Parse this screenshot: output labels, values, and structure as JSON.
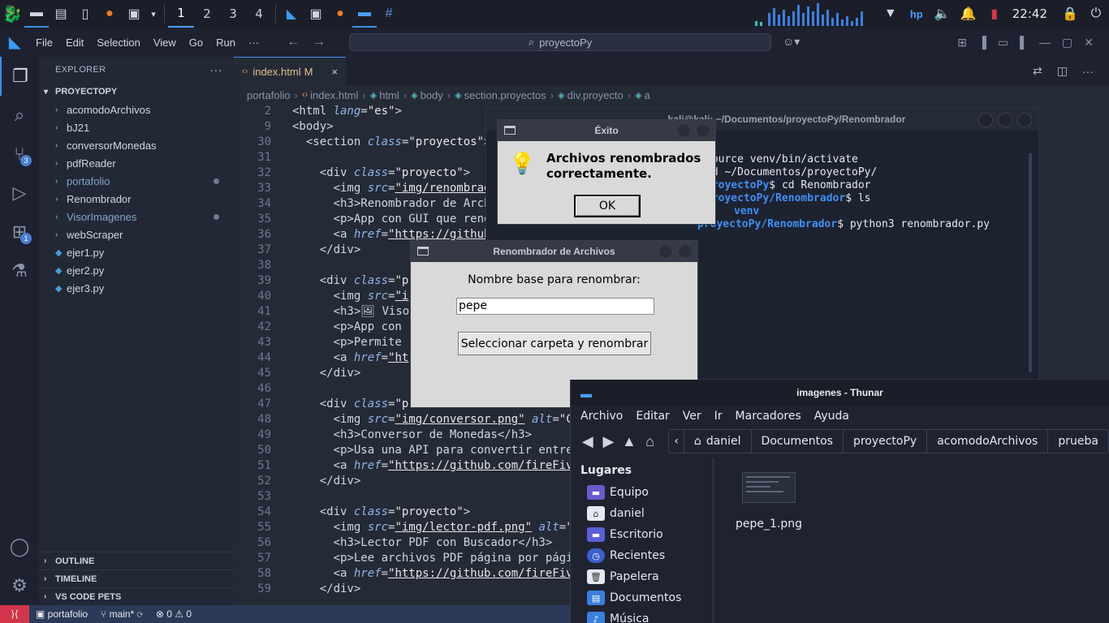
{
  "taskbar": {
    "workspaces": [
      "1",
      "2",
      "3",
      "4"
    ],
    "clock": "22:42",
    "icons": [
      "kali-menu-icon",
      "desktop-icon",
      "files-icon",
      "text-editor-icon",
      "firefox-icon",
      "terminal-icon",
      "vscode-icon",
      "terminal-icon",
      "firefox-icon",
      "files-icon",
      "hashtag-app-icon",
      "wifi-icon",
      "hp-icon",
      "volume-icon",
      "bell-icon",
      "battery-icon",
      "lock-icon",
      "power-icon"
    ]
  },
  "vscode": {
    "menus": [
      "File",
      "Edit",
      "Selection",
      "View",
      "Go",
      "Run",
      "···"
    ],
    "search": "proyectoPy",
    "explorer_title": "EXPLORER",
    "explorer_more": "···",
    "root": "PROYECTOPY",
    "tree": [
      {
        "name": "acomodoArchivos",
        "type": "folder",
        "modified": false
      },
      {
        "name": "bJ21",
        "type": "folder",
        "modified": false
      },
      {
        "name": "conversorMonedas",
        "type": "folder",
        "modified": false
      },
      {
        "name": "pdfReader",
        "type": "folder",
        "modified": false
      },
      {
        "name": "portafolio",
        "type": "folder",
        "modified": true
      },
      {
        "name": "Renombrador",
        "type": "folder",
        "modified": false
      },
      {
        "name": "VisorImagenes",
        "type": "folder",
        "modified": true
      },
      {
        "name": "webScraper",
        "type": "folder",
        "modified": false
      },
      {
        "name": "ejer1.py",
        "type": "file",
        "modified": false
      },
      {
        "name": "ejer2.py",
        "type": "file",
        "modified": false
      },
      {
        "name": "ejer3.py",
        "type": "file",
        "modified": false
      }
    ],
    "bottom_sections": [
      "OUTLINE",
      "TIMELINE",
      "VS CODE PETS"
    ],
    "badges": {
      "scm": "3",
      "extensions": "1"
    },
    "tab": {
      "label": "index.html",
      "status": "M",
      "close": "×"
    },
    "breadcrumb": [
      "portafolio",
      "index.html",
      "html",
      "body",
      "section.proyectos",
      "div.proyecto",
      "a"
    ],
    "line_numbers": [
      "2",
      "9",
      "30",
      "31",
      "32",
      "33",
      "34",
      "35",
      "36",
      "37",
      "38",
      "39",
      "40",
      "41",
      "42",
      "43",
      "44",
      "45",
      "46",
      "47",
      "48",
      "49",
      "50",
      "51",
      "52",
      "53",
      "54",
      "55",
      "56",
      "57",
      "58",
      "59"
    ],
    "statusbar": {
      "branch_folder": "portafolio",
      "branch": "main*",
      "errors": "0",
      "warnings": "0"
    }
  },
  "terminal": {
    "title": "kali@kali: ~/Documentos/proyectoPy/Renombrador",
    "lines": [
      "source venv/bin/activate",
      "cd ~/Documentos/proyectoPy/",
      "cd Renombrador",
      "ls",
      "venv",
      "python3 renombrador.py"
    ],
    "path_main": "proyectoPy",
    "path_renom": "proyectoPy/Renombrador"
  },
  "exito": {
    "title": "Éxito",
    "message": "Archivos renombrados correctamente.",
    "ok": "OK"
  },
  "renombrador": {
    "title": "Renombrador de Archivos",
    "label": "Nombre base para renombrar:",
    "input_value": "pepe",
    "button": "Seleccionar carpeta y renombrar"
  },
  "thunar": {
    "title": "imagenes - Thunar",
    "menu": [
      "Archivo",
      "Editar",
      "Ver",
      "Ir",
      "Marcadores",
      "Ayuda"
    ],
    "path": [
      "daniel",
      "Documentos",
      "proyectoPy",
      "acomodoArchivos",
      "prueba"
    ],
    "places_title": "Lugares",
    "places": [
      "Equipo",
      "daniel",
      "Escritorio",
      "Recientes",
      "Papelera",
      "Documentos",
      "Música"
    ],
    "file": "pepe_1.png"
  },
  "colors": {
    "accent": "#3f8fe8",
    "statusbar": "#2b3a56",
    "remote": "#d2364a"
  }
}
